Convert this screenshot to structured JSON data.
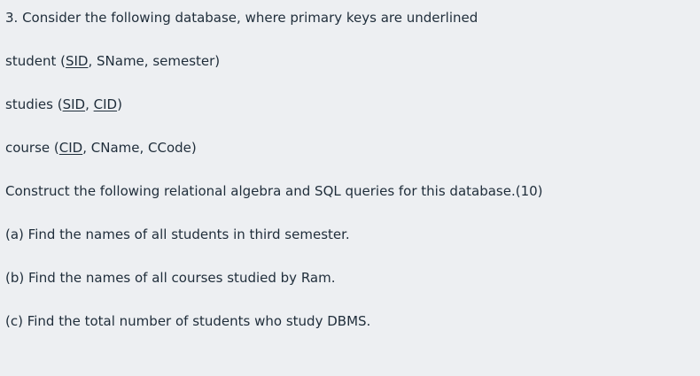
{
  "question": {
    "intro": "3. Consider the following database, where primary keys are underlined",
    "relations": [
      {
        "name": "student",
        "open": " (",
        "key1": "SID",
        "sep1": ", SName, semester)"
      },
      {
        "name": "studies",
        "open": " (",
        "key1": "SID",
        "sep1": ", ",
        "key2": "CID",
        "close": ")"
      },
      {
        "name": "course",
        "open": " (",
        "key1": "CID",
        "sep1": ", CName, CCode)"
      }
    ],
    "instruction": "Construct the following relational algebra and SQL queries for this database.(10)",
    "parts": [
      "(a) Find the names of all students in third semester.",
      "(b) Find the names of all courses studied by Ram.",
      "(c) Find the total number of students who study DBMS."
    ]
  }
}
